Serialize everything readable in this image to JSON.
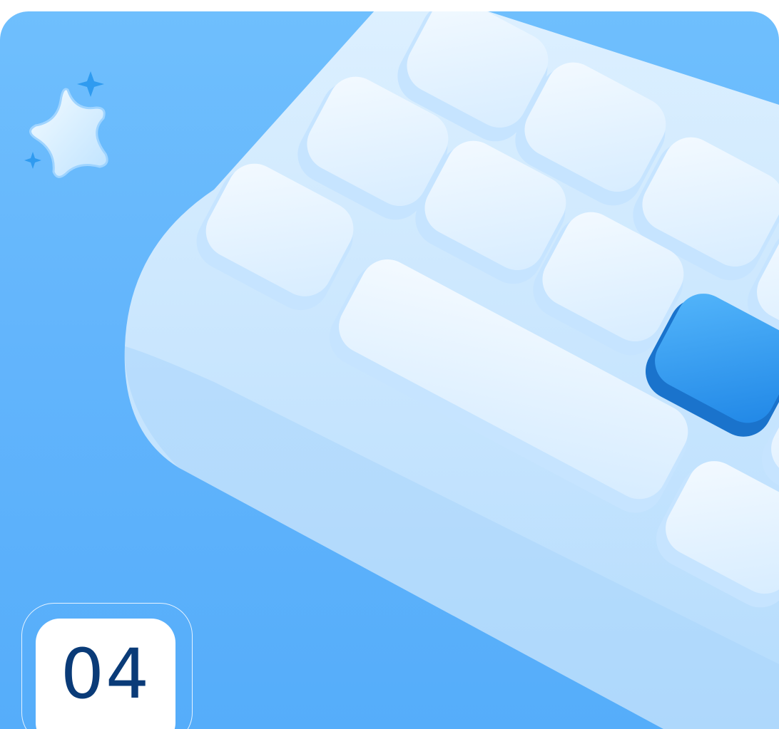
{
  "badge": {
    "number": "04"
  },
  "colors": {
    "background_top": "#6fbffd",
    "background_bottom": "#55adfa",
    "keyboard_body": "#cfe9fe",
    "key_light": "#e8f5ff",
    "key_accent": "#2f9bf0",
    "badge_text": "#0a3b78"
  },
  "icons": {
    "sparkle": "sparkle-star-icon"
  }
}
